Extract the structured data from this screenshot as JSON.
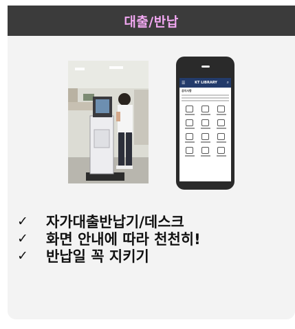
{
  "header": {
    "title": "대출/반납"
  },
  "photo": {
    "subject": "self-checkout-kiosk-photo"
  },
  "phone": {
    "app": {
      "logo_text": "KT LIBRARY",
      "notice_title": "공지사항"
    }
  },
  "bullets": [
    {
      "check": "✓",
      "text": "자가대출반납기/데스크"
    },
    {
      "check": "✓",
      "text": "화면 안내에 따라 천천히!"
    },
    {
      "check": "✓",
      "text": "반납일 꼭 지키기"
    }
  ],
  "colors": {
    "header_bg": "#3b3b3b",
    "header_text": "#f2a8f2",
    "card_bg": "#f3f3f3",
    "app_bar": "#233b6b"
  }
}
